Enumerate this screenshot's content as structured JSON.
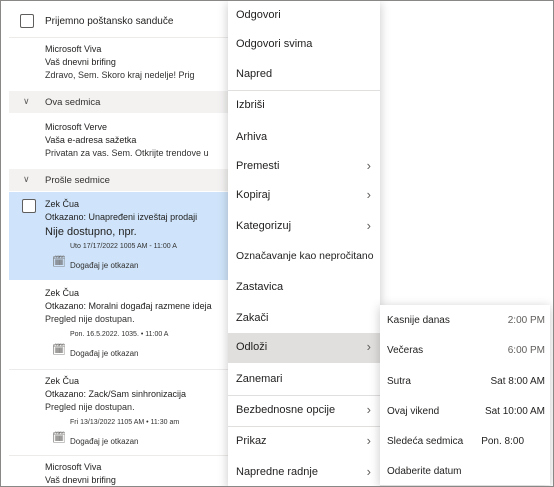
{
  "mail_list": {
    "header_title": "Prijemno poštansko sanduče",
    "items": [
      {
        "sender": "Microsoft Viva",
        "subject": "Vaš dnevni brifing",
        "preview": "Zdravo, Sem. Skoro kraj nedelje! Prig"
      },
      {
        "sender": "Microsoft Verve",
        "subject": "Vaša e-adresa sažetka",
        "preview": "Privatan za vas. Sem. Otkrijte trendove u"
      },
      {
        "sender": "Zek Čua",
        "subject": "Otkazano: Unapređeni izveštaj prodaji",
        "preview": "Nije dostupno, npr.",
        "event_time": "Uto 17/17/2022 1005 AM - 11:00 A",
        "event_status": "Događaj je otkazan"
      },
      {
        "sender": "Zek Čua",
        "subject": "Otkazano: Moralni događaj razmene ideja",
        "preview": "Pregled nije dostupan.",
        "event_time": "Pon. 16.5.2022. 1035. • 11:00 A",
        "event_status": "Događaj je otkazan"
      },
      {
        "sender": "Zek Čua",
        "subject": "Otkazano: Zack/Sam sinhronizacija",
        "preview": "Pregled nije dostupan.",
        "event_time": "Fri 13/13/2022 1105 AM • 11:30 am",
        "event_status": "Događaj je otkazan"
      },
      {
        "sender": "Microsoft Viva",
        "subject": "Vaš dnevni brifing"
      }
    ],
    "groups": [
      {
        "label": "Ova sedmica",
        "chevron": "chevron-down-icon"
      },
      {
        "label": "Prošle sedmice",
        "chevron": "chevron-down-icon"
      }
    ]
  },
  "context_menu": {
    "items": [
      {
        "label": "Odgovori"
      },
      {
        "label": "Odgovori svima"
      },
      {
        "label": "Napred"
      },
      {
        "label": "Izbriši"
      },
      {
        "label": "Arhiva"
      },
      {
        "label": "Premesti",
        "submenu": true
      },
      {
        "label": "Kopiraj",
        "submenu": true
      },
      {
        "label": "Kategorizuj",
        "submenu": true
      },
      {
        "label": "Označavanje kao nepročitano"
      },
      {
        "label": "Zastavica"
      },
      {
        "label": "Zakači"
      },
      {
        "label": "Odloži",
        "submenu": true,
        "highlighted": true
      },
      {
        "label": "Zanemari"
      },
      {
        "label": "Bezbednosne opcije",
        "submenu": true
      },
      {
        "label": "Prikaz",
        "submenu": true
      },
      {
        "label": "Napredne radnje",
        "submenu": true
      }
    ]
  },
  "snooze_submenu": {
    "items": [
      {
        "label": "Kasnije danas",
        "time": "2:00 PM"
      },
      {
        "label": "Večeras",
        "time": "6:00 PM"
      },
      {
        "label": "Sutra",
        "time": "Sat 8:00 AM"
      },
      {
        "label": "Ovaj vikend",
        "time": "Sat 10:00 AM"
      },
      {
        "label": "Sledeća sedmica",
        "time": "Pon. 8:00"
      },
      {
        "label": "Odaberite datum"
      }
    ]
  },
  "icons": {
    "submenu_arrow": "chevron-right-icon",
    "calendar_cancel": "calendar-cancel-icon",
    "checkbox": "checkbox-icon"
  },
  "colors": {
    "selected_row": "#cfe4fa",
    "menu_highlight": "#e1dfdd",
    "group_header": "#f3f2f1"
  }
}
